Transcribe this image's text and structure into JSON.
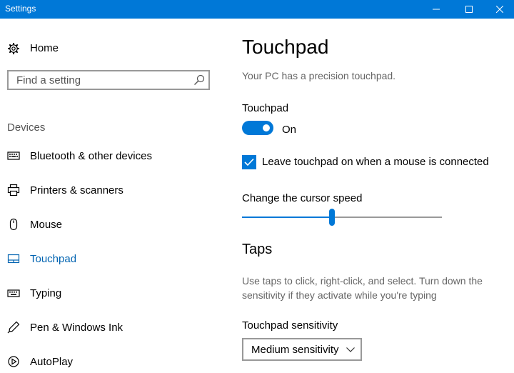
{
  "window": {
    "title": "Settings",
    "controls": [
      "minimize-icon",
      "maximize-icon",
      "close-icon"
    ]
  },
  "sidebar": {
    "home": {
      "label": "Home",
      "icon": "gear-icon"
    },
    "search": {
      "placeholder": "Find a setting",
      "value": "",
      "icon": "search-icon"
    },
    "section_label": "Devices",
    "items": [
      {
        "label": "Bluetooth & other devices",
        "icon": "bluetooth-devices-icon",
        "active": false
      },
      {
        "label": "Printers & scanners",
        "icon": "printer-icon",
        "active": false
      },
      {
        "label": "Mouse",
        "icon": "mouse-icon",
        "active": false
      },
      {
        "label": "Touchpad",
        "icon": "touchpad-icon",
        "active": true
      },
      {
        "label": "Typing",
        "icon": "keyboard-icon",
        "active": false
      },
      {
        "label": "Pen & Windows Ink",
        "icon": "pen-icon",
        "active": false
      },
      {
        "label": "AutoPlay",
        "icon": "autoplay-icon",
        "active": false
      }
    ]
  },
  "main": {
    "title": "Touchpad",
    "subtitle": "Your PC has a precision touchpad.",
    "touchpad_label": "Touchpad",
    "toggle": {
      "state": "On",
      "checked": true
    },
    "checkbox": {
      "label": "Leave touchpad on when a mouse is connected",
      "checked": true
    },
    "cursor_speed": {
      "label": "Change the cursor speed",
      "value_fraction": 0.45
    },
    "taps": {
      "title": "Taps",
      "description": "Use taps to click, right-click, and select. Turn down the sensitivity if they activate while you're typing",
      "sensitivity_label": "Touchpad sensitivity",
      "sensitivity_value": "Medium sensitivity"
    }
  },
  "colors": {
    "accent": "#0078d7",
    "active_nav_text": "#0063b1",
    "secondary_text": "#666666"
  }
}
